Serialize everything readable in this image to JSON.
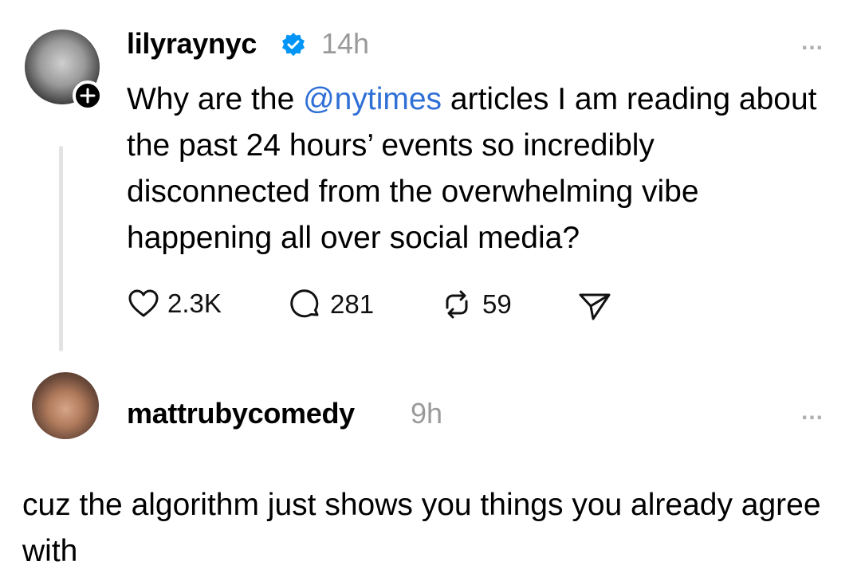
{
  "post": {
    "username": "lilyraynyc",
    "time": "14h",
    "more_label": "...",
    "text_before": "Why are the ",
    "mention": "@nytimes",
    "text_after": " articles I am reading about the past 24 hours’ events so incredibly disconnected from the overwhelming vibe happening all over social media?",
    "likes": "2.3K",
    "replies": "281",
    "reposts": "59"
  },
  "reply": {
    "username": "mattrubycomedy",
    "time": "9h",
    "more_label": "...",
    "text": "cuz the algorithm just shows you things you already agree with"
  },
  "colors": {
    "mention": "#2f6fd6",
    "verified": "#0095f6",
    "timestamp": "#9a9a9a"
  },
  "icons": [
    "verified-icon",
    "plus-icon",
    "heart-icon",
    "comment-icon",
    "repost-icon",
    "share-icon",
    "more-icon"
  ]
}
